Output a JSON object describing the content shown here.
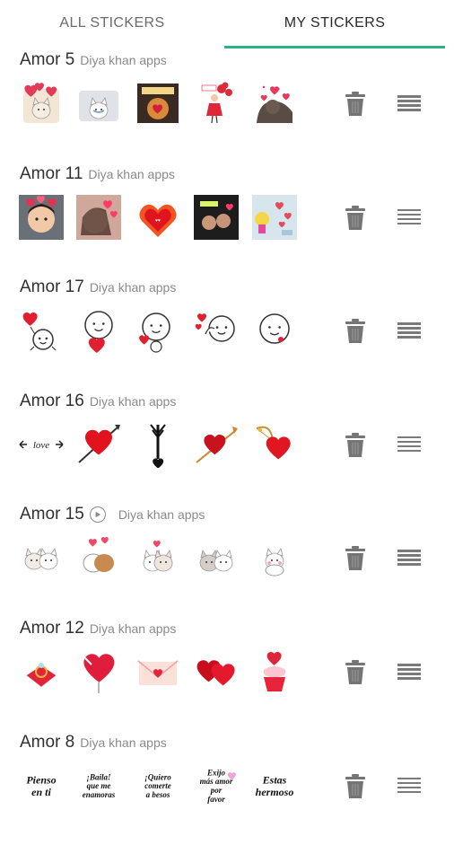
{
  "tabs": [
    {
      "label": "ALL STICKERS",
      "selected": false
    },
    {
      "label": "MY STICKERS",
      "selected": true
    }
  ],
  "accent_color": "#2bb08c",
  "packs": [
    {
      "name": "Amor 5",
      "author": "Diya khan apps",
      "animated": false,
      "stickers": [
        "cat-with-hearts",
        "white-cat-crying",
        "loving-tiger-cartoon",
        "girl-with-red-balloons",
        "bear-with-heart-rain"
      ]
    },
    {
      "name": "Amor 11",
      "author": "Diya khan apps",
      "animated": false,
      "stickers": [
        "girl-with-flower-crown",
        "girl-with-hearts",
        "flaming-heart-text",
        "couple-photo-hearts",
        "cartoon-with-pink-hearts"
      ]
    },
    {
      "name": "Amor 17",
      "author": "Diya khan apps",
      "animated": false,
      "stickers": [
        "cute-face-heart-balloon",
        "cute-face-holding-heart",
        "cute-face-kissing",
        "cute-face-waving-hearts",
        "cute-face-smiling"
      ]
    },
    {
      "name": "Amor 16",
      "author": "Diya khan apps",
      "animated": false,
      "stickers": [
        "love-arrow-lettering",
        "heart-with-arrow",
        "black-arrow-with-heart",
        "red-heart-arrow",
        "heart-with-cupid-bow"
      ]
    },
    {
      "name": "Amor 15",
      "author": "Diya khan apps",
      "animated": true,
      "stickers": [
        "hugging-cats",
        "bears-with-hearts",
        "cats-cuddling",
        "two-cats-together",
        "white-cat-happy"
      ]
    },
    {
      "name": "Amor 12",
      "author": "Diya khan apps",
      "animated": false,
      "stickers": [
        "ring-box",
        "heart-balloon",
        "love-letter-envelope",
        "two-red-hearts",
        "heart-cupcake"
      ]
    },
    {
      "name": "Amor 8",
      "author": "Diya khan apps",
      "animated": false,
      "stickers": [
        "pienso-en-ti-text",
        "bailal-que-me-enamoras-text",
        "quiero-comerte-a-besos-text",
        "exijo-mas-amor-por-favor-text",
        "estas-hermoso-text"
      ],
      "sticker_texts": [
        "Pienso en ti",
        "¡Baila! que me enamoras",
        "¡Quiero comerte a besos",
        "Exijo más amor por favor",
        "Estas hermoso"
      ]
    }
  ],
  "icons": {
    "delete": "trash-icon",
    "reorder": "drag-handle-icon",
    "animated": "play-circle-icon"
  }
}
